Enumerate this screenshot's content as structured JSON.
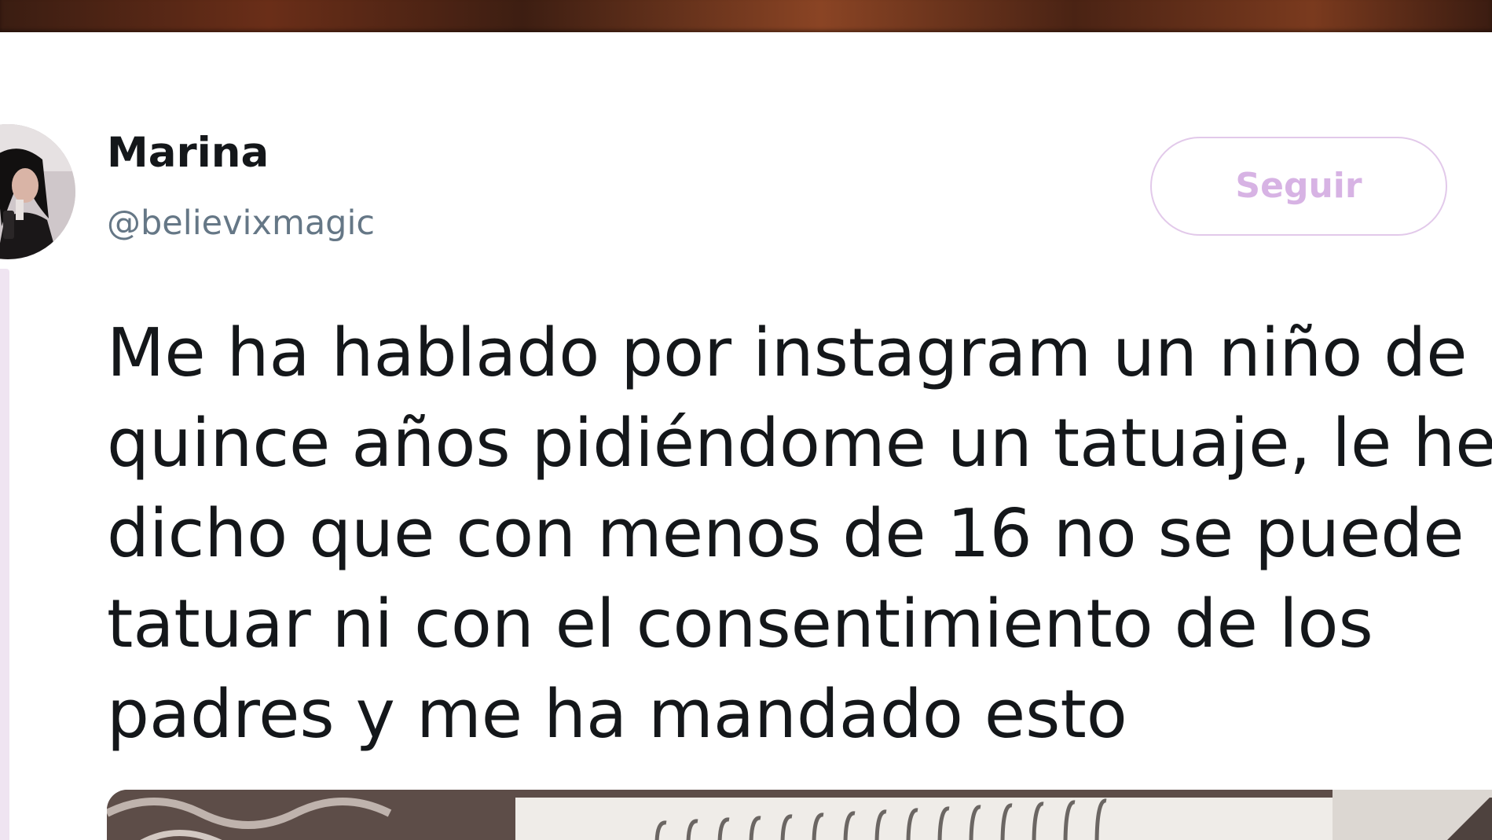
{
  "header_banner": {
    "icon": "banner-image"
  },
  "tweet": {
    "avatar_icon": "user-avatar-photo",
    "display_name": "Marina",
    "handle": "@believixmagic",
    "follow_button_label": "Seguir",
    "text_lines": [
      "Me ha hablado por instagram un niño de",
      "quince años pidiéndome un tatuaje, le he",
      "dicho que con menos de 16 no se puede",
      "tatuar ni con el consentimiento de los",
      "padres y me ha mandado esto"
    ],
    "media_icon": "attached-photo"
  },
  "colors": {
    "text_primary": "#14171a",
    "text_secondary": "#657786",
    "follow_button_border": "#e2c9ea",
    "follow_button_text": "#d7b3e4",
    "thread_line": "#efe4f1"
  }
}
